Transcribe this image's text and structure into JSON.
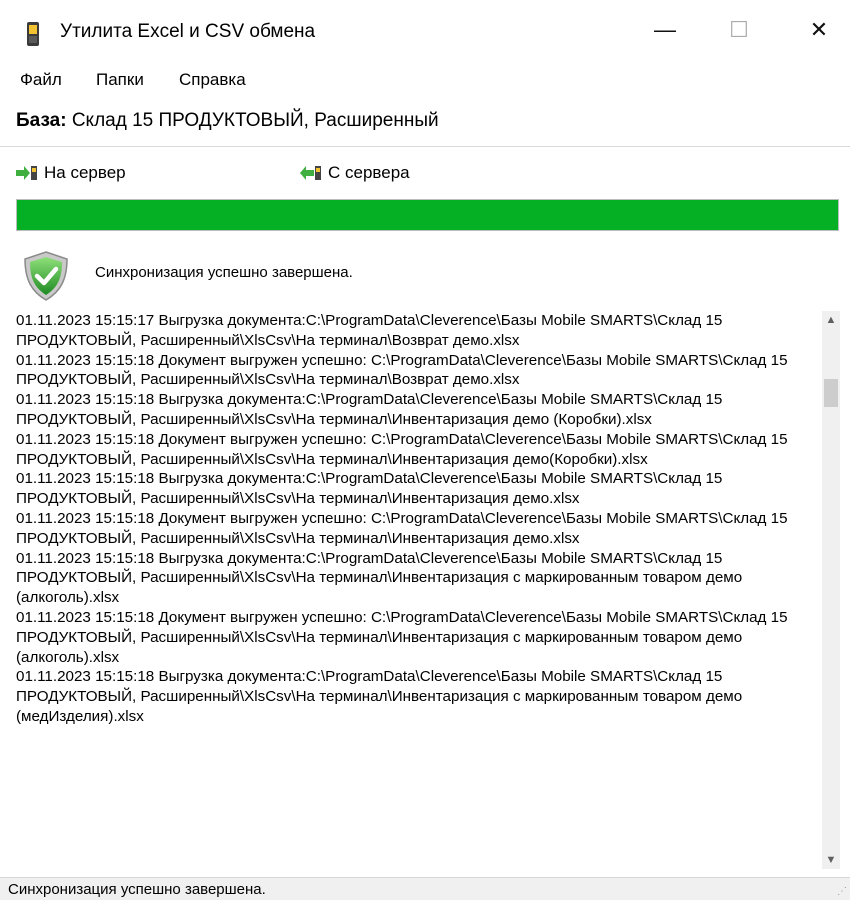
{
  "window": {
    "title": "Утилита Excel и CSV обмена",
    "minimize_glyph": "—",
    "maximize_glyph": "☐",
    "close_glyph": "✕"
  },
  "menu": {
    "items": [
      {
        "label": "Файл"
      },
      {
        "label": "Папки"
      },
      {
        "label": "Справка"
      }
    ]
  },
  "database": {
    "label": "База:",
    "value": "Склад 15 ПРОДУКТОВЫЙ, Расширенный"
  },
  "actions": {
    "to_server": {
      "label": "На сервер",
      "icon": "upload-arrow-icon"
    },
    "from_server": {
      "label": "С сервера",
      "icon": "download-arrow-icon"
    }
  },
  "progress": {
    "percent": 100,
    "color": "#06b025"
  },
  "status": {
    "icon": "shield-check-icon",
    "message": "Синхронизация успешно завершена."
  },
  "log": [
    "01.11.2023 15:15:17  Выгрузка документа:C:\\ProgramData\\Cleverence\\Базы Mobile SMARTS\\Склад 15 ПРОДУКТОВЫЙ, Расширенный\\XlsCsv\\На терминал\\Возврат демо.xlsx",
    "01.11.2023 15:15:18  Документ выгружен успешно: C:\\ProgramData\\Cleverence\\Базы Mobile SMARTS\\Склад 15 ПРОДУКТОВЫЙ, Расширенный\\XlsCsv\\На терминал\\Возврат демо.xlsx",
    "01.11.2023 15:15:18  Выгрузка документа:C:\\ProgramData\\Cleverence\\Базы Mobile SMARTS\\Склад 15 ПРОДУКТОВЫЙ, Расширенный\\XlsCsv\\На терминал\\Инвентаризация демо (Коробки).xlsx",
    "01.11.2023 15:15:18  Документ выгружен успешно: C:\\ProgramData\\Cleverence\\Базы Mobile SMARTS\\Склад 15 ПРОДУКТОВЫЙ, Расширенный\\XlsCsv\\На терминал\\Инвентаризация демо(Коробки).xlsx",
    "01.11.2023 15:15:18  Выгрузка документа:C:\\ProgramData\\Cleverence\\Базы Mobile SMARTS\\Склад 15 ПРОДУКТОВЫЙ, Расширенный\\XlsCsv\\На терминал\\Инвентаризация демо.xlsx",
    "01.11.2023 15:15:18  Документ выгружен успешно: C:\\ProgramData\\Cleverence\\Базы Mobile SMARTS\\Склад 15 ПРОДУКТОВЫЙ, Расширенный\\XlsCsv\\На терминал\\Инвентаризация демо.xlsx",
    "01.11.2023 15:15:18  Выгрузка документа:C:\\ProgramData\\Cleverence\\Базы Mobile SMARTS\\Склад 15 ПРОДУКТОВЫЙ, Расширенный\\XlsCsv\\На терминал\\Инвентаризация с маркированным товаром демо (алкоголь).xlsx",
    "01.11.2023 15:15:18  Документ выгружен успешно: C:\\ProgramData\\Cleverence\\Базы Mobile SMARTS\\Склад 15 ПРОДУКТОВЫЙ, Расширенный\\XlsCsv\\На терминал\\Инвентаризация с маркированным товаром демо (алкоголь).xlsx",
    "01.11.2023 15:15:18  Выгрузка документа:C:\\ProgramData\\Cleverence\\Базы Mobile SMARTS\\Склад 15 ПРОДУКТОВЫЙ, Расширенный\\XlsCsv\\На терминал\\Инвентаризация с маркированным товаром демо (медИзделия).xlsx"
  ],
  "statusbar": {
    "text": "Синхронизация успешно завершена."
  }
}
